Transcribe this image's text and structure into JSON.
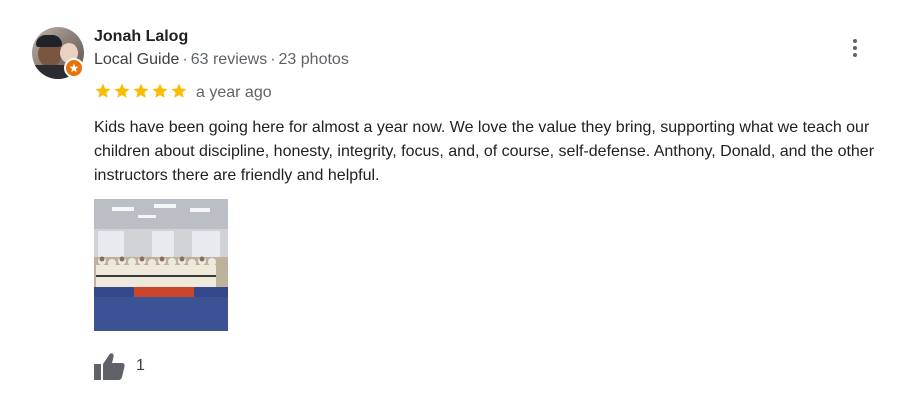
{
  "review": {
    "author": {
      "name": "Jonah Lalog",
      "badge": "Local Guide",
      "reviews": "63 reviews",
      "photos": "23 photos"
    },
    "rating": 5,
    "time": "a year ago",
    "text": "Kids have been going here for almost a year now. We love the value they bring, supporting what we teach our children about discipline, honesty, integrity, focus, and, of course, self-defense. Anthony, Donald, and the other instructors there are friendly and helpful.",
    "likes": "1",
    "meta_separator": "·"
  },
  "colors": {
    "star": "#fbbc04",
    "guide_badge": "#e8710a",
    "secondary_text": "#5f6368"
  },
  "icons": [
    "more-vert-icon",
    "star-icon",
    "thumbs-up-icon",
    "local-guide-badge-icon"
  ]
}
